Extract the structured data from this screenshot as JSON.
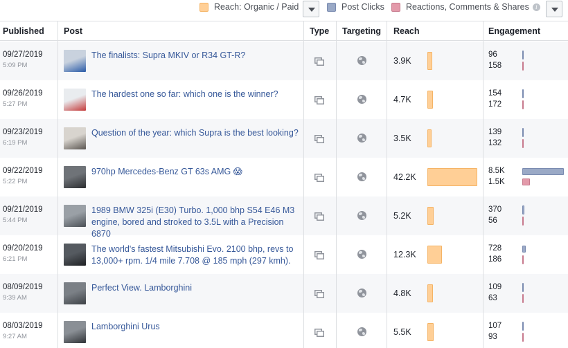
{
  "legend": {
    "reach_label": "Reach: Organic / Paid",
    "clicks_label": "Post Clicks",
    "reactions_label": "Reactions, Comments & Shares",
    "info_glyph": "i",
    "reach_color": "#ffcf96",
    "clicks_color": "#9aa9c6",
    "reactions_color": "#e39aaa"
  },
  "columns": {
    "published": "Published",
    "post": "Post",
    "type": "Type",
    "targeting": "Targeting",
    "reach": "Reach",
    "engagement": "Engagement"
  },
  "rows": [
    {
      "date": "09/27/2019",
      "time": "5:09 PM",
      "text": "The finalists: Supra MKIV or R34 GT-R?",
      "reach_label": "3.9K",
      "reach": 3900,
      "clicks_label": "96",
      "clicks": 96,
      "reactions_label": "158",
      "reactions": 158,
      "thumb": [
        "#c9d2de",
        "#2a5ba8"
      ]
    },
    {
      "date": "09/26/2019",
      "time": "5:27 PM",
      "text": "The hardest one so far: which one is the winner?",
      "reach_label": "4.7K",
      "reach": 4700,
      "clicks_label": "154",
      "clicks": 154,
      "reactions_label": "172",
      "reactions": 172,
      "thumb": [
        "#e9ecef",
        "#c43a3a"
      ]
    },
    {
      "date": "09/23/2019",
      "time": "6:19 PM",
      "text": "Question of the year: which Supra is the best looking?",
      "reach_label": "3.5K",
      "reach": 3500,
      "clicks_label": "139",
      "clicks": 139,
      "reactions_label": "132",
      "reactions": 132,
      "thumb": [
        "#d8d4ce",
        "#5a5550"
      ]
    },
    {
      "date": "09/22/2019",
      "time": "5:22 PM",
      "text": "970hp Mercedes-Benz GT 63s AMG 😱",
      "reach_label": "42.2K",
      "reach": 42200,
      "clicks_label": "8.5K",
      "clicks": 8500,
      "reactions_label": "1.5K",
      "reactions": 1500,
      "thumb": [
        "#6f7378",
        "#2b2d30"
      ]
    },
    {
      "date": "09/21/2019",
      "time": "5:44 PM",
      "text": "1989 BMW 325i (E30) Turbo. 1,000 bhp S54 E46 M3 engine, bored and stroked to 3.5L with a Precision 6870",
      "reach_label": "5.2K",
      "reach": 5200,
      "clicks_label": "370",
      "clicks": 370,
      "reactions_label": "56",
      "reactions": 56,
      "thumb": [
        "#9aa0a6",
        "#4a4f55"
      ]
    },
    {
      "date": "09/20/2019",
      "time": "6:21 PM",
      "text": "The world's fastest Mitsubishi Evo. 2100 bhp, revs to 13,000+ rpm. 1/4 mile 7.708 @ 185 mph (297 kmh).",
      "reach_label": "12.3K",
      "reach": 12300,
      "clicks_label": "728",
      "clicks": 728,
      "reactions_label": "186",
      "reactions": 186,
      "thumb": [
        "#555a60",
        "#1f2124"
      ]
    },
    {
      "date": "08/09/2019",
      "time": "9:39 AM",
      "text": "Perfect View. Lamborghini",
      "reach_label": "4.8K",
      "reach": 4800,
      "clicks_label": "109",
      "clicks": 109,
      "reactions_label": "63",
      "reactions": 63,
      "thumb": [
        "#7b8086",
        "#3d4146"
      ]
    },
    {
      "date": "08/03/2019",
      "time": "9:27 AM",
      "text": "Lamborghini Urus",
      "reach_label": "5.5K",
      "reach": 5500,
      "clicks_label": "107",
      "clicks": 107,
      "reactions_label": "93",
      "reactions": 93,
      "thumb": [
        "#8a8f95",
        "#2f3236"
      ]
    }
  ]
}
